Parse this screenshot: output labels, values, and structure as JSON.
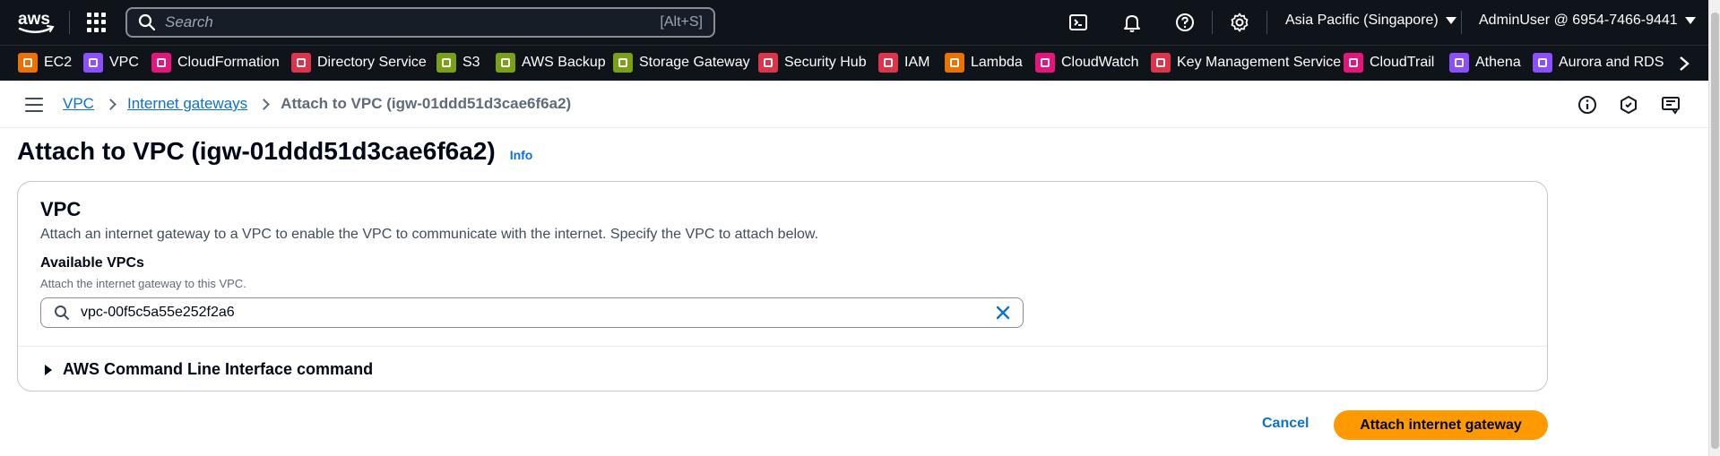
{
  "topnav": {
    "logo_text": "aws",
    "search_placeholder": "Search",
    "search_shortcut": "[Alt+S]",
    "region": "Asia Pacific (Singapore)",
    "account": "AdminUser @ 6954-7466-9441",
    "icons": [
      "services-grid-icon",
      "cloudshell-icon",
      "bell-icon",
      "help-icon",
      "gear-icon"
    ]
  },
  "servicebar": {
    "items": [
      {
        "label": "EC2",
        "color": "#ed7100"
      },
      {
        "label": "VPC",
        "color": "#8c4fff"
      },
      {
        "label": "CloudFormation",
        "color": "#e7157b"
      },
      {
        "label": "Directory Service",
        "color": "#dd344c"
      },
      {
        "label": "S3",
        "color": "#7aa116"
      },
      {
        "label": "AWS Backup",
        "color": "#7aa116"
      },
      {
        "label": "Storage Gateway",
        "color": "#7aa116"
      },
      {
        "label": "Security Hub",
        "color": "#dd344c"
      },
      {
        "label": "IAM",
        "color": "#dd344c"
      },
      {
        "label": "Lambda",
        "color": "#ed7100"
      },
      {
        "label": "CloudWatch",
        "color": "#e7157b"
      },
      {
        "label": "Key Management Service",
        "color": "#dd344c"
      },
      {
        "label": "CloudTrail",
        "color": "#e7157b"
      },
      {
        "label": "Athena",
        "color": "#8c4fff"
      },
      {
        "label": "Aurora and RDS",
        "color": "#8c4fff"
      }
    ]
  },
  "breadcrumb": {
    "items": [
      "VPC",
      "Internet gateways"
    ],
    "current": "Attach to VPC (igw-01ddd51d3cae6f6a2)"
  },
  "page": {
    "title": "Attach to VPC (igw-01ddd51d3cae6f6a2)",
    "info": "Info"
  },
  "vpc_panel": {
    "title": "VPC",
    "description": "Attach an internet gateway to a VPC to enable the VPC to communicate with the internet. Specify the VPC to attach below.",
    "field_label": "Available VPCs",
    "field_description": "Attach the internet gateway to this VPC.",
    "field_value": "vpc-00f5c5a55e252f2a6",
    "cli_expander": "AWS Command Line Interface command"
  },
  "actions": {
    "cancel": "Cancel",
    "primary": "Attach internet gateway"
  }
}
